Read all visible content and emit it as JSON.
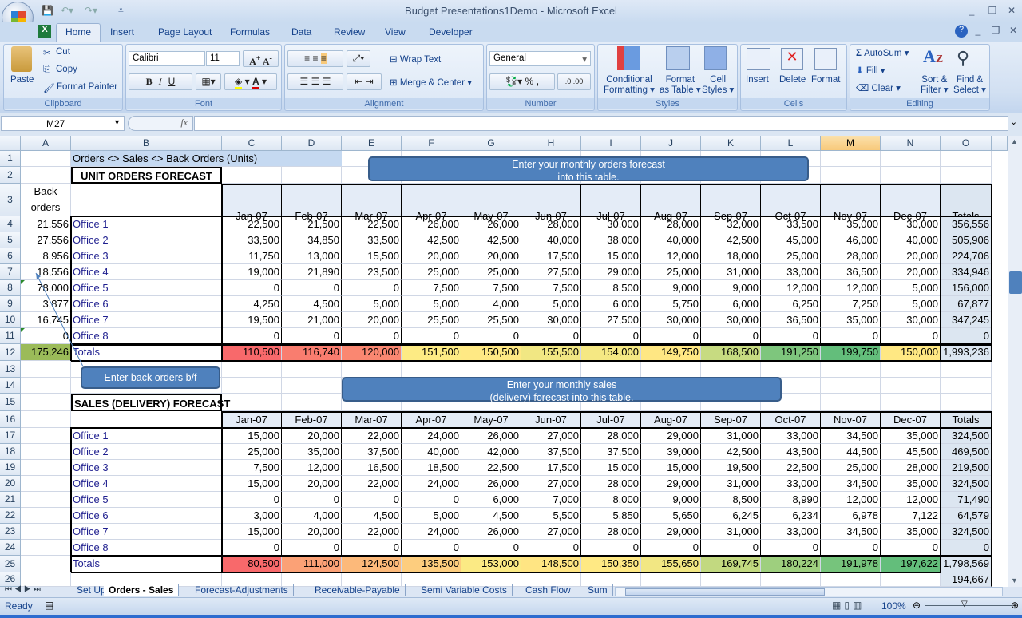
{
  "window": {
    "title": "Budget Presentations1Demo - Microsoft Excel"
  },
  "ribbon": {
    "tabs": [
      "Home",
      "Insert",
      "Page Layout",
      "Formulas",
      "Data",
      "Review",
      "View",
      "Developer"
    ],
    "active_tab": "Home",
    "clipboard": {
      "label": "Clipboard",
      "paste": "Paste",
      "cut": "Cut",
      "copy": "Copy",
      "format_painter": "Format Painter"
    },
    "font": {
      "label": "Font",
      "name": "Calibri",
      "size": "11",
      "bold": "B",
      "italic": "I",
      "underline": "U"
    },
    "alignment": {
      "label": "Alignment",
      "wrap_text": "Wrap Text",
      "merge_center": "Merge & Center"
    },
    "number": {
      "label": "Number",
      "format": "General",
      "percent": "%",
      "comma": ","
    },
    "styles": {
      "label": "Styles",
      "conditional": "Conditional",
      "conditional2": "Formatting",
      "format_table": "Format",
      "format_table2": "as Table",
      "cell_styles": "Cell",
      "cell_styles2": "Styles"
    },
    "cells": {
      "label": "Cells",
      "insert": "Insert",
      "delete": "Delete",
      "format": "Format"
    },
    "editing": {
      "label": "Editing",
      "autosum": "AutoSum",
      "fill": "Fill",
      "clear": "Clear",
      "sort": "Sort &",
      "sort2": "Filter",
      "find": "Find &",
      "find2": "Select"
    }
  },
  "formula_bar": {
    "name_box": "M27",
    "fx": "fx",
    "formula": ""
  },
  "columns": [
    "A",
    "B",
    "C",
    "D",
    "E",
    "F",
    "G",
    "H",
    "I",
    "J",
    "K",
    "L",
    "M",
    "N",
    "O"
  ],
  "selected_column": "M",
  "sheet": {
    "title": "Orders <> Sales <> Back Orders (Units)",
    "orders": {
      "heading": "UNIT ORDERS FORECAST",
      "back_orders_header": "Back orders",
      "months": [
        "Jan-07",
        "Feb-07",
        "Mar-07",
        "Apr-07",
        "May-07",
        "Jun-07",
        "Jul-07",
        "Aug-07",
        "Sep-07",
        "Oct-07",
        "Nov-07",
        "Dec-07"
      ],
      "totals_header": "Totals",
      "rows": [
        {
          "back": "21,556",
          "office": "Office 1",
          "values": [
            "22,500",
            "21,500",
            "22,500",
            "26,000",
            "26,000",
            "28,000",
            "30,000",
            "28,000",
            "32,000",
            "33,500",
            "35,000",
            "30,000"
          ],
          "total": "356,556"
        },
        {
          "back": "27,556",
          "office": "Office 2",
          "values": [
            "33,500",
            "34,850",
            "33,500",
            "42,500",
            "42,500",
            "40,000",
            "38,000",
            "40,000",
            "42,500",
            "45,000",
            "46,000",
            "40,000"
          ],
          "total": "505,906"
        },
        {
          "back": "8,956",
          "office": "Office 3",
          "values": [
            "11,750",
            "13,000",
            "15,500",
            "20,000",
            "20,000",
            "17,500",
            "15,000",
            "12,000",
            "18,000",
            "25,000",
            "28,000",
            "20,000"
          ],
          "total": "224,706"
        },
        {
          "back": "18,556",
          "office": "Office 4",
          "values": [
            "19,000",
            "21,890",
            "23,500",
            "25,000",
            "25,000",
            "27,500",
            "29,000",
            "25,000",
            "31,000",
            "33,000",
            "36,500",
            "20,000"
          ],
          "total": "334,946"
        },
        {
          "back": "78,000",
          "office": "Office 5",
          "values": [
            "0",
            "0",
            "0",
            "7,500",
            "7,500",
            "7,500",
            "8,500",
            "9,000",
            "9,000",
            "12,000",
            "12,000",
            "5,000"
          ],
          "total": "156,000"
        },
        {
          "back": "3,877",
          "office": "Office 6",
          "values": [
            "4,250",
            "4,500",
            "5,000",
            "5,000",
            "4,000",
            "5,000",
            "6,000",
            "5,750",
            "6,000",
            "6,250",
            "7,250",
            "5,000"
          ],
          "total": "67,877"
        },
        {
          "back": "16,745",
          "office": "Office 7",
          "values": [
            "19,500",
            "21,000",
            "20,000",
            "25,500",
            "25,500",
            "30,000",
            "27,500",
            "30,000",
            "30,000",
            "36,500",
            "35,000",
            "30,000"
          ],
          "total": "347,245"
        },
        {
          "back": "0",
          "office": "Office 8",
          "values": [
            "0",
            "0",
            "0",
            "0",
            "0",
            "0",
            "0",
            "0",
            "0",
            "0",
            "0",
            "0"
          ],
          "total": "0"
        }
      ],
      "totals": {
        "back": "175,246",
        "label": "Totals",
        "values": [
          "110,500",
          "116,740",
          "120,000",
          "151,500",
          "150,500",
          "155,500",
          "154,000",
          "149,750",
          "168,500",
          "191,250",
          "199,750",
          "150,000"
        ],
        "total": "1,993,236"
      }
    },
    "sales": {
      "heading": "SALES (DELIVERY) FORECAST",
      "months": [
        "Jan-07",
        "Feb-07",
        "Mar-07",
        "Apr-07",
        "May-07",
        "Jun-07",
        "Jul-07",
        "Aug-07",
        "Sep-07",
        "Oct-07",
        "Nov-07",
        "Dec-07"
      ],
      "totals_header": "Totals",
      "rows": [
        {
          "office": "Office 1",
          "values": [
            "15,000",
            "20,000",
            "22,000",
            "24,000",
            "26,000",
            "27,000",
            "28,000",
            "29,000",
            "31,000",
            "33,000",
            "34,500",
            "35,000"
          ],
          "total": "324,500"
        },
        {
          "office": "Office 2",
          "values": [
            "25,000",
            "35,000",
            "37,500",
            "40,000",
            "42,000",
            "37,500",
            "37,500",
            "39,000",
            "42,500",
            "43,500",
            "44,500",
            "45,500"
          ],
          "total": "469,500"
        },
        {
          "office": "Office 3",
          "values": [
            "7,500",
            "12,000",
            "16,500",
            "18,500",
            "22,500",
            "17,500",
            "15,000",
            "15,000",
            "19,500",
            "22,500",
            "25,000",
            "28,000"
          ],
          "total": "219,500"
        },
        {
          "office": "Office 4",
          "values": [
            "15,000",
            "20,000",
            "22,000",
            "24,000",
            "26,000",
            "27,000",
            "28,000",
            "29,000",
            "31,000",
            "33,000",
            "34,500",
            "35,000"
          ],
          "total": "324,500"
        },
        {
          "office": "Office 5",
          "values": [
            "0",
            "0",
            "0",
            "0",
            "6,000",
            "7,000",
            "8,000",
            "9,000",
            "8,500",
            "8,990",
            "12,000",
            "12,000"
          ],
          "total": "71,490"
        },
        {
          "office": "Office 6",
          "values": [
            "3,000",
            "4,000",
            "4,500",
            "5,000",
            "4,500",
            "5,500",
            "5,850",
            "5,650",
            "6,245",
            "6,234",
            "6,978",
            "7,122"
          ],
          "total": "64,579"
        },
        {
          "office": "Office 7",
          "values": [
            "15,000",
            "20,000",
            "22,000",
            "24,000",
            "26,000",
            "27,000",
            "28,000",
            "29,000",
            "31,000",
            "33,000",
            "34,500",
            "35,000"
          ],
          "total": "324,500"
        },
        {
          "office": "Office 8",
          "values": [
            "0",
            "0",
            "0",
            "0",
            "0",
            "0",
            "0",
            "0",
            "0",
            "0",
            "0",
            "0"
          ],
          "total": "0"
        }
      ],
      "totals": {
        "label": "Totals",
        "values": [
          "80,500",
          "111,000",
          "124,500",
          "135,500",
          "153,000",
          "148,500",
          "150,350",
          "155,650",
          "169,745",
          "180,224",
          "191,978",
          "197,622"
        ],
        "total": "1,798,569"
      },
      "row26_total": "194,667"
    },
    "callouts": {
      "orders": "Enter your monthly  orders forecast\ninto this table.",
      "back_orders": "Enter back orders b/f",
      "sales": "Enter your monthly sales\n(delivery) forecast into this table."
    }
  },
  "heat_colors": {
    "low": "#F8696B",
    "mid": "#FFEB84",
    "high": "#63BE7B"
  },
  "sheet_tabs": [
    "Set Up",
    "Orders - Sales",
    "Forecast-Adjustments",
    "Receivable-Payable",
    "Semi Variable Costs",
    "Cash Flow",
    "Sum"
  ],
  "active_sheet": "Orders - Sales",
  "status": {
    "ready": "Ready",
    "zoom": "100%"
  }
}
